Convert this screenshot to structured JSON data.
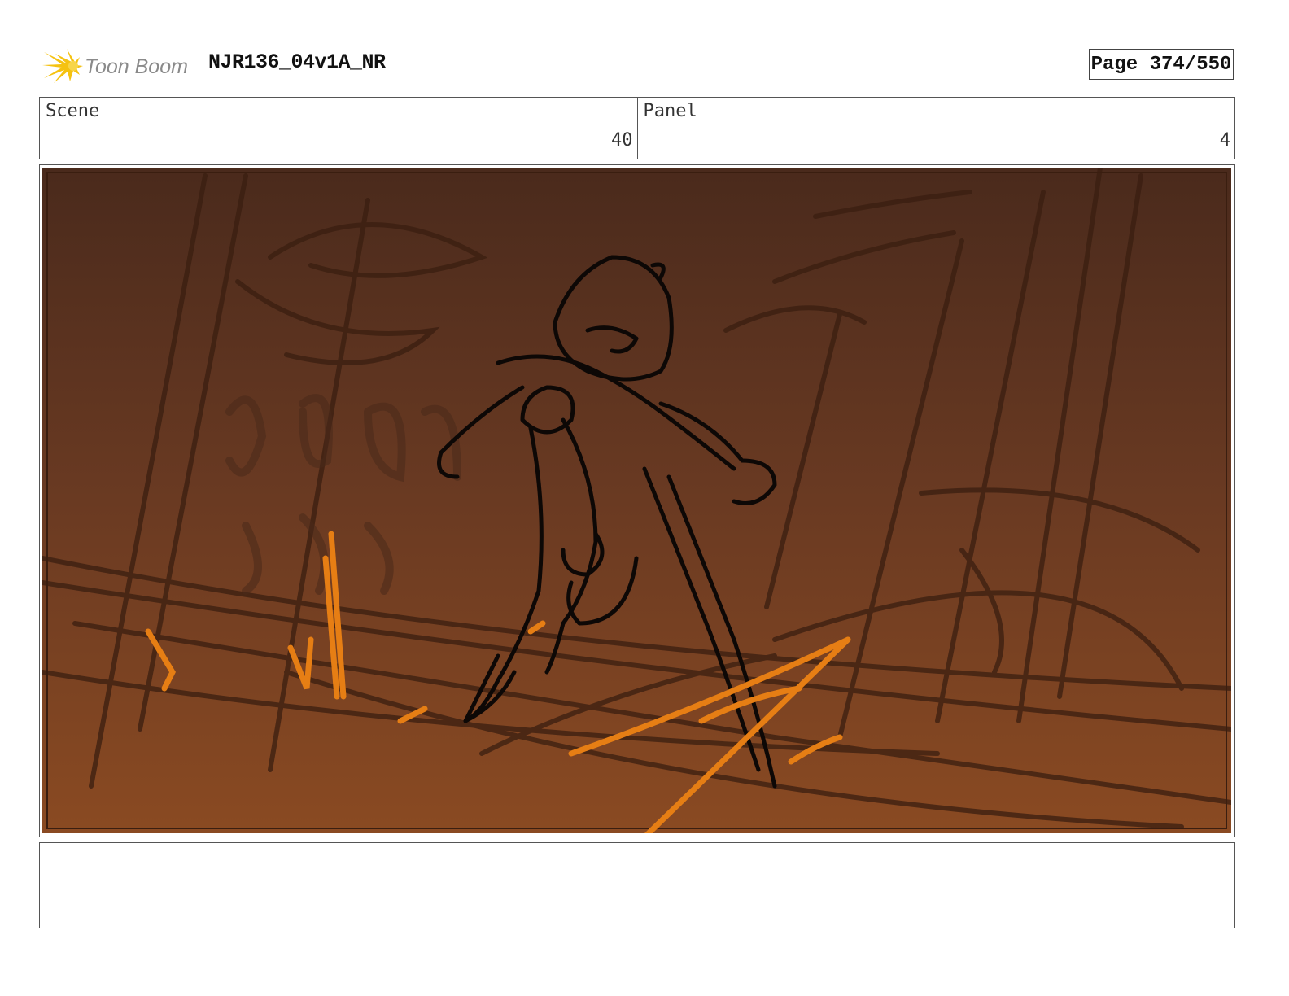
{
  "header": {
    "logo_text": "Toon Boom",
    "project_title": "NJR136_04v1A_NR",
    "page_label": "Page 374/550"
  },
  "info": {
    "scene_label": "Scene",
    "scene_value": "40",
    "panel_label": "Panel",
    "panel_value": "4"
  },
  "panel": {
    "background_colors": [
      "#4a2a1c",
      "#6a3a22",
      "#8a4a22"
    ],
    "sketch_color": "#0d0806",
    "background_line_color": "#3a1e10",
    "accent_color": "#e67e14"
  },
  "notes": {
    "text": ""
  }
}
